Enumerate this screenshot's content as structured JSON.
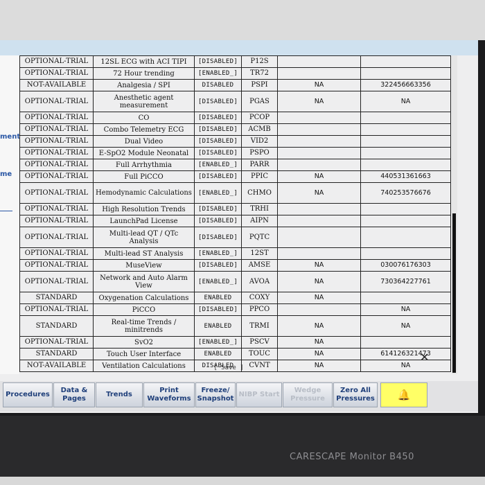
{
  "device": {
    "brand_label": "CARESCAPE Monitor B450"
  },
  "sidebar": {
    "labels": [
      "ment",
      "me"
    ]
  },
  "table": {
    "rows": [
      [
        "OPTIONAL-TRIAL",
        "12SL ECG with ACI TIPI",
        "[DISABLED]",
        "P12S",
        "",
        ""
      ],
      [
        "OPTIONAL-TRIAL",
        "72 Hour trending",
        "[ENABLED_]",
        "TR72",
        "",
        ""
      ],
      [
        "NOT-AVAILABLE",
        "Analgesia / SPI",
        "DISABLED",
        "PSPI",
        "NA",
        "322456663356"
      ],
      [
        "OPTIONAL-TRIAL",
        "Anesthetic agent measurement",
        "[DISABLED]",
        "PGAS",
        "NA",
        "NA"
      ],
      [
        "OPTIONAL-TRIAL",
        "CO",
        "[DISABLED]",
        "PCOP",
        "",
        ""
      ],
      [
        "OPTIONAL-TRIAL",
        "Combo Telemetry ECG",
        "[DISABLED]",
        "ACMB",
        "",
        ""
      ],
      [
        "OPTIONAL-TRIAL",
        "Dual Video",
        "[DISABLED]",
        "VID2",
        "",
        ""
      ],
      [
        "OPTIONAL-TRIAL",
        "E-SpO2 Module Neonatal",
        "[DISABLED]",
        "PSPO",
        "",
        ""
      ],
      [
        "OPTIONAL-TRIAL",
        "Full Arrhythmia",
        "[ENABLED_]",
        "PARR",
        "",
        ""
      ],
      [
        "OPTIONAL-TRIAL",
        "Full PiCCO",
        "[DISABLED]",
        "PPIC",
        "NA",
        "440531361663"
      ],
      [
        "OPTIONAL-TRIAL",
        "Hemodynamic Calculations",
        "[ENABLED_]",
        "CHMO",
        "NA",
        "740253576676"
      ],
      [
        "OPTIONAL-TRIAL",
        "High Resolution Trends",
        "[DISABLED]",
        "TRHI",
        "",
        ""
      ],
      [
        "OPTIONAL-TRIAL",
        "LaunchPad License",
        "[DISABLED]",
        "AIPN",
        "",
        ""
      ],
      [
        "OPTIONAL-TRIAL",
        "Multi-lead QT / QTc Analysis",
        "[DISABLED]",
        "PQTC",
        "",
        ""
      ],
      [
        "OPTIONAL-TRIAL",
        "Multi-lead ST Analysis",
        "[ENABLED_]",
        "12ST",
        "",
        ""
      ],
      [
        "OPTIONAL-TRIAL",
        "MuseView",
        "[DISABLED]",
        "AMSE",
        "NA",
        "030076176303"
      ],
      [
        "OPTIONAL-TRIAL",
        "Network and Auto Alarm View",
        "[ENABLED_]",
        "AVOA",
        "NA",
        "730364227761"
      ],
      [
        "STANDARD",
        "Oxygenation Calculations",
        "ENABLED",
        "COXY",
        "NA",
        ""
      ],
      [
        "OPTIONAL-TRIAL",
        "PiCCO",
        "[DISABLED]",
        "PPCO",
        "",
        "NA"
      ],
      [
        "STANDARD",
        "Real-time Trends / minitrends",
        "ENABLED",
        "TRMI",
        "NA",
        "NA"
      ],
      [
        "OPTIONAL-TRIAL",
        "SvO2",
        "[ENABLED_]",
        "PSCV",
        "NA",
        ""
      ],
      [
        "STANDARD",
        "Touch User Interface",
        "ENABLED",
        "TOUC",
        "NA",
        "614126321473"
      ],
      [
        "NOT-AVAILABLE",
        "Ventilation Calculations",
        "DISABLED",
        "CVNT",
        "NA",
        "NA"
      ]
    ]
  },
  "save_label": "[ Save ]",
  "toolbar": {
    "buttons": [
      {
        "label": "Procedures",
        "enabled": true
      },
      {
        "label": "Data & Pages",
        "enabled": true
      },
      {
        "label": "Trends",
        "enabled": true
      },
      {
        "label": "Print Waveforms",
        "enabled": true
      },
      {
        "label": "Freeze/ Snapshot",
        "enabled": true
      },
      {
        "label": "NIBP Start",
        "enabled": false
      },
      {
        "label": "Wedge Pressure",
        "enabled": false
      },
      {
        "label": "Zero All Pressures",
        "enabled": true
      }
    ],
    "alarm_icon": "bell-icon"
  },
  "colors": {
    "accent_blue": "#2a57a5",
    "alarm_yellow": "#ffff66"
  }
}
